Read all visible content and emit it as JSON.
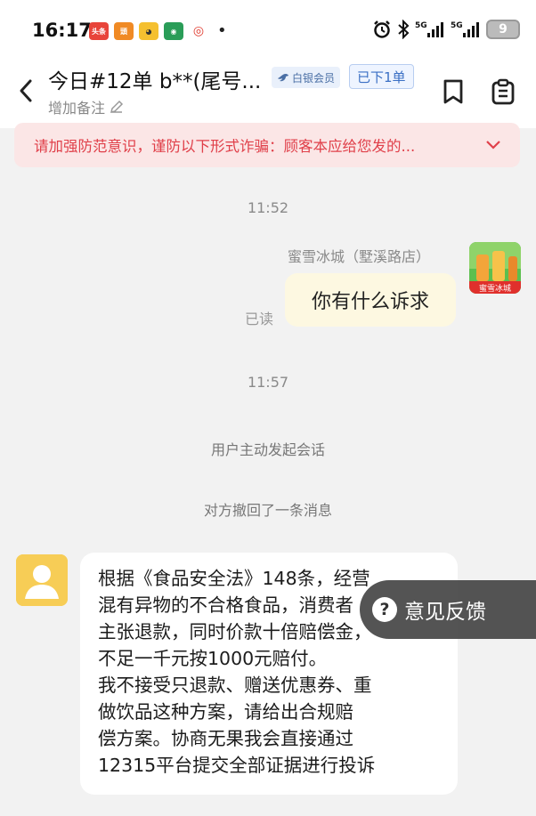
{
  "status_bar": {
    "time": "16:17",
    "battery": "9",
    "network_1": "5G",
    "network_2": "5G",
    "app_icons": [
      "toutiao-app-icon",
      "news-app-icon",
      "yellow-app-icon",
      "map-app-icon",
      "weibo-app-icon"
    ]
  },
  "header": {
    "title": "今日#12单 b**(尾号...",
    "member_badge": "白银会员",
    "order_badge": "已下1单",
    "remark": "增加备注"
  },
  "warning": {
    "text": "请加强防范意识，谨防以下形式诈骗：顾客本应给您发的..."
  },
  "chat": {
    "timestamp_1": "11:52",
    "sender_name": "蜜雪冰城（墅溪路店）",
    "store_message": "你有什么诉求",
    "read_status": "已读",
    "timestamp_2": "11:57",
    "system_1": "用户主动发起会话",
    "system_2": "对方撤回了一条消息",
    "customer_message": "根据《食品安全法》148条，经营\n混有异物的不合格食品，消费者\n主张退款，同时价款十倍赔偿金，\n不足一千元按1000元赔付。\n我不接受只退款、赠送优惠券、重\n做饮品这种方案，请给出合规赔\n偿方案。协商无果我会直接通过\n12315平台提交全部证据进行投诉",
    "store_avatar_text": "蜜雪冰城"
  },
  "feedback": {
    "icon": "?",
    "label": "意见反馈"
  },
  "colors": {
    "warning_text": "#e0404a",
    "warning_bg": "#fbe6e6",
    "outgoing_bubble": "#fdf8e1",
    "order_badge": "#3a6fc4"
  }
}
